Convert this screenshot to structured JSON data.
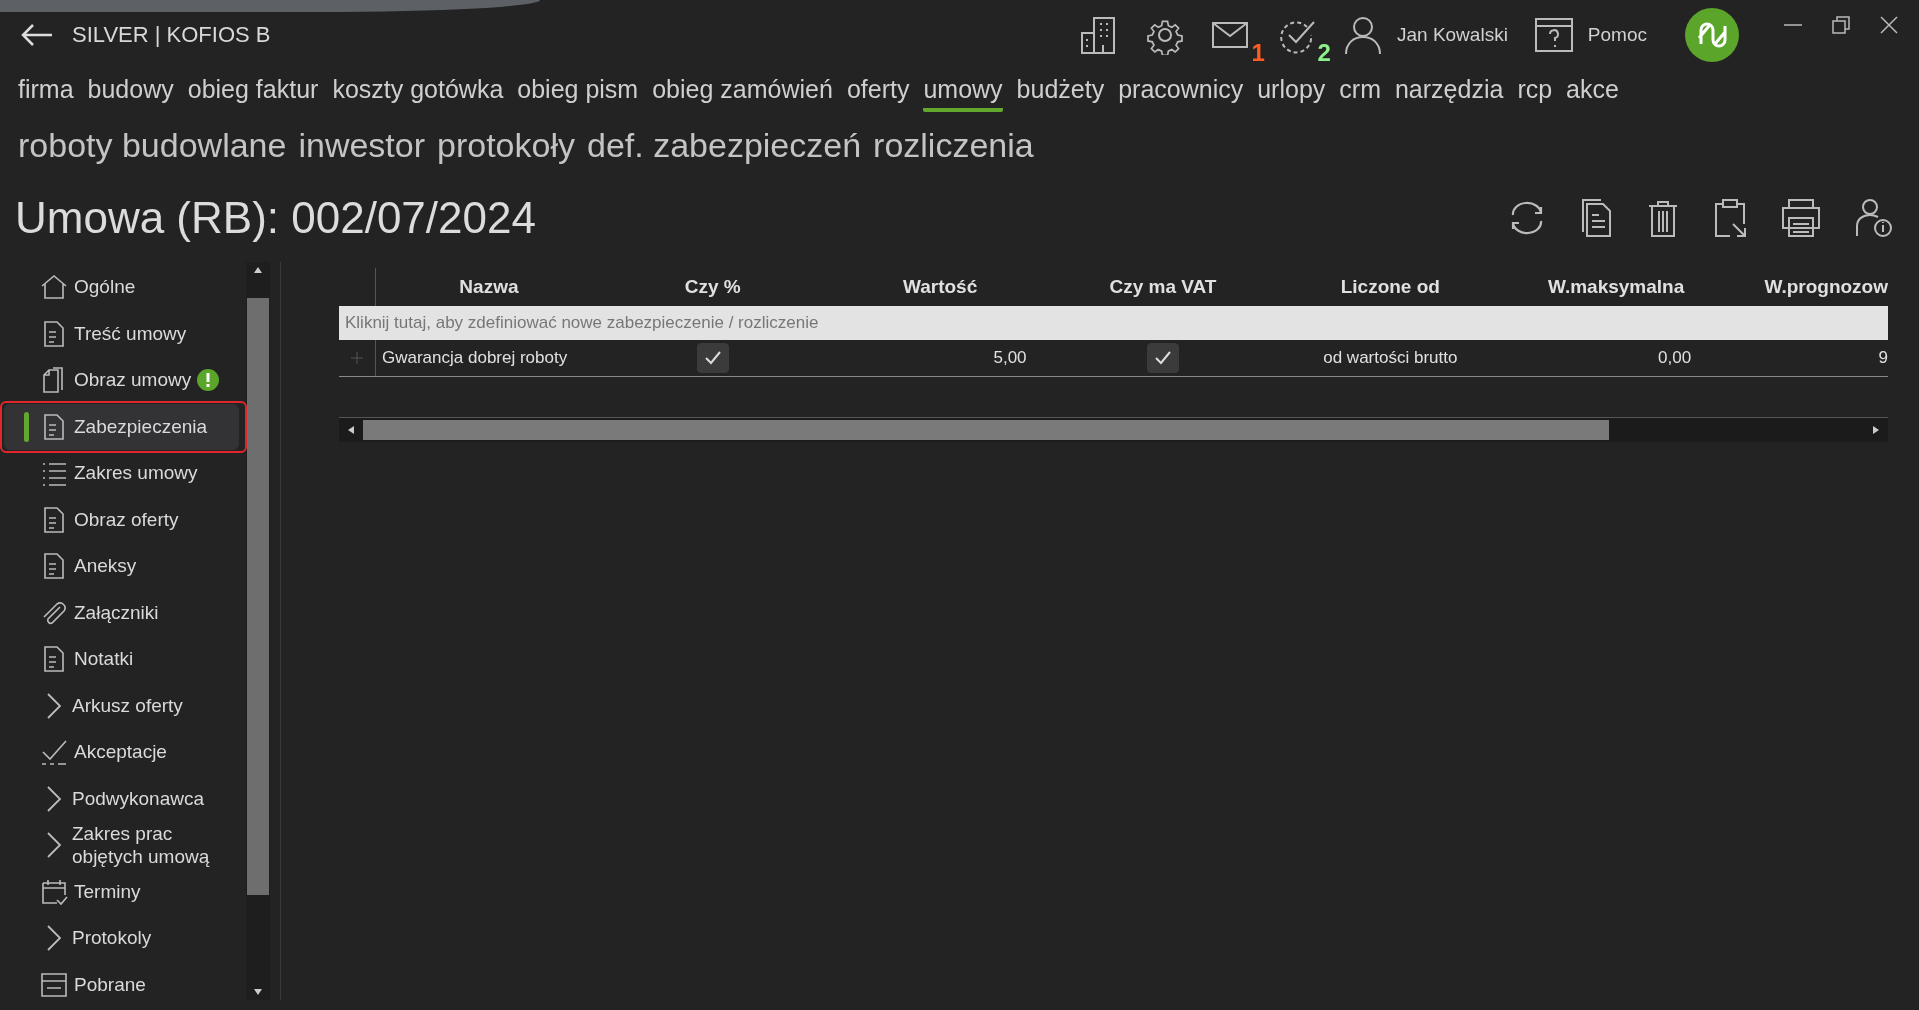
{
  "app_title": "SILVER | KOFIOS B",
  "header": {
    "mail_badge": {
      "text": "1",
      "color": "#ff5a1f"
    },
    "tasks_badge": {
      "text": "2",
      "color": "#8ef08a"
    },
    "user": "Jan Kowalski",
    "help": "Pomoc"
  },
  "nav": [
    {
      "label": "firma",
      "selected": false
    },
    {
      "label": "budowy",
      "selected": false
    },
    {
      "label": "obieg faktur",
      "selected": false
    },
    {
      "label": "koszty gotówka",
      "selected": false
    },
    {
      "label": "obieg pism",
      "selected": false
    },
    {
      "label": "obieg zamówień",
      "selected": false
    },
    {
      "label": "oferty",
      "selected": false
    },
    {
      "label": "umowy",
      "selected": true
    },
    {
      "label": "budżety",
      "selected": false
    },
    {
      "label": "pracownicy",
      "selected": false
    },
    {
      "label": "urlopy",
      "selected": false
    },
    {
      "label": "crm",
      "selected": false
    },
    {
      "label": "narzędzia",
      "selected": false
    },
    {
      "label": "rcp",
      "selected": false
    },
    {
      "label": "akce",
      "selected": false
    }
  ],
  "subnav": [
    "roboty budowlane",
    "inwestor",
    "protokoły",
    "def. zabezpieczeń",
    "rozliczenia"
  ],
  "page_title": "Umowa (RB): 002/07/2024",
  "sidebar": [
    {
      "label": "Ogólne",
      "kind": "page",
      "selected": false,
      "alert": false
    },
    {
      "label": "Treść umowy",
      "kind": "page",
      "selected": false,
      "alert": false
    },
    {
      "label": "Obraz umowy",
      "kind": "page",
      "selected": false,
      "alert": true
    },
    {
      "label": "Zabezpieczenia",
      "kind": "page",
      "selected": true,
      "alert": false
    },
    {
      "label": "Zakres umowy",
      "kind": "page",
      "selected": false,
      "alert": false
    },
    {
      "label": "Obraz oferty",
      "kind": "page",
      "selected": false,
      "alert": false
    },
    {
      "label": "Aneksy",
      "kind": "page",
      "selected": false,
      "alert": false
    },
    {
      "label": "Załączniki",
      "kind": "page",
      "selected": false,
      "alert": false
    },
    {
      "label": "Notatki",
      "kind": "page",
      "selected": false,
      "alert": false
    },
    {
      "label": "Arkusz oferty",
      "kind": "group",
      "selected": false,
      "alert": false
    },
    {
      "label": "Akceptacje",
      "kind": "page",
      "selected": false,
      "alert": false
    },
    {
      "label": "Podwykonawca",
      "kind": "group",
      "selected": false,
      "alert": false
    },
    {
      "label": "Zakres prac objętych umową",
      "kind": "group",
      "selected": false,
      "alert": false
    },
    {
      "label": "Terminy",
      "kind": "page",
      "selected": false,
      "alert": false
    },
    {
      "label": "Protokoly",
      "kind": "group",
      "selected": false,
      "alert": false
    },
    {
      "label": "Pobrane",
      "kind": "page",
      "selected": false,
      "alert": false
    }
  ],
  "table": {
    "columns": [
      "Nazwa",
      "Czy %",
      "Wartość",
      "Czy ma VAT",
      "Liczone od",
      "W.maksymalna",
      "W.prognozow"
    ],
    "new_row_placeholder": "Kliknij tutaj, aby zdefiniować nowe zabezpieczenie / rozliczenie",
    "rows": [
      {
        "name": "Gwarancja dobrej roboty",
        "percent": true,
        "value": "5,00",
        "vat": true,
        "base": "od wartości brutto",
        "max": "0,00",
        "forecast": "9"
      }
    ]
  }
}
